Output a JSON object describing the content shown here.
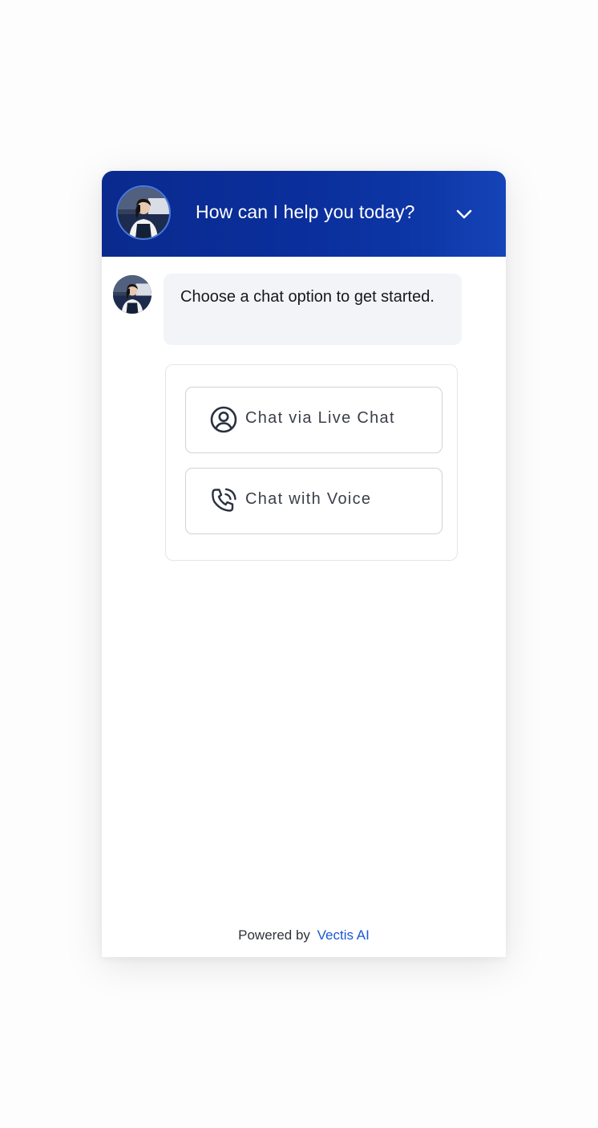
{
  "header": {
    "title": "How can I help you today?",
    "avatar_icon": "agent-avatar",
    "collapse_icon": "chevron-down-icon",
    "gradient_start": "#0a2a8e",
    "gradient_end": "#1544b8"
  },
  "message": {
    "text": "Choose a chat option to get started.",
    "bubble_color": "#f2f4f7"
  },
  "options": [
    {
      "label": "Chat via Live Chat",
      "icon": "user-circle-icon"
    },
    {
      "label": "Chat with Voice",
      "icon": "phone-call-icon"
    }
  ],
  "footer": {
    "powered_by": "Powered by",
    "brand": "Vectis AI",
    "brand_color": "#1a56d6"
  }
}
